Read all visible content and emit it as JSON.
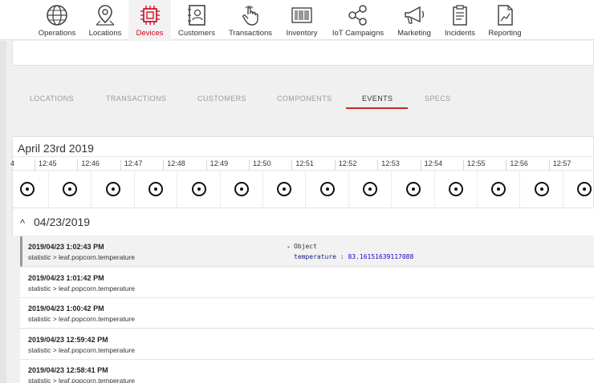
{
  "nav": {
    "items": [
      {
        "label": "Operations",
        "icon": "globe-icon"
      },
      {
        "label": "Locations",
        "icon": "map-pin-icon"
      },
      {
        "label": "Devices",
        "icon": "chip-icon"
      },
      {
        "label": "Customers",
        "icon": "contact-book-icon"
      },
      {
        "label": "Transactions",
        "icon": "tap-hand-icon"
      },
      {
        "label": "Inventory",
        "icon": "barcode-icon"
      },
      {
        "label": "IoT Campaigns",
        "icon": "share-icon"
      },
      {
        "label": "Marketing",
        "icon": "megaphone-icon"
      },
      {
        "label": "Incidents",
        "icon": "clipboard-icon"
      },
      {
        "label": "Reporting",
        "icon": "report-chart-icon"
      }
    ],
    "active": "Devices"
  },
  "tabs": [
    "LOCATIONS",
    "TRANSACTIONS",
    "CUSTOMERS",
    "COMPONENTS",
    "EVENTS",
    "SPECS"
  ],
  "active_tab": "EVENTS",
  "timeline": {
    "title": "April 23rd 2019",
    "partial_label": "4",
    "times": [
      "12:45",
      "12:46",
      "12:47",
      "12:48",
      "12:49",
      "12:50",
      "12:51",
      "12:52",
      "12:53",
      "12:54",
      "12:55",
      "12:56",
      "12:57"
    ]
  },
  "group": {
    "date": "04/23/2019",
    "chevron": "^"
  },
  "events": [
    {
      "time": "2019/04/23 1:02:43 PM",
      "path": "statistic > leaf.popcorn.temperature"
    },
    {
      "time": "2019/04/23 1:01:42 PM",
      "path": "statistic > leaf.popcorn.temperature"
    },
    {
      "time": "2019/04/23 1:00:42 PM",
      "path": "statistic > leaf.popcorn.temperature"
    },
    {
      "time": "2019/04/23 12:59:42 PM",
      "path": "statistic > leaf.popcorn.temperature"
    },
    {
      "time": "2019/04/23 12:58:41 PM",
      "path": "statistic > leaf.popcorn.temperature"
    }
  ],
  "detail": {
    "triangle": "▸",
    "object": "Object",
    "key": "temperature",
    "separator": " : ",
    "value": "83.16151639117088"
  },
  "colors": {
    "accent": "#d0021b",
    "tab_underline": "#c62828",
    "value": "#1c00cf"
  }
}
